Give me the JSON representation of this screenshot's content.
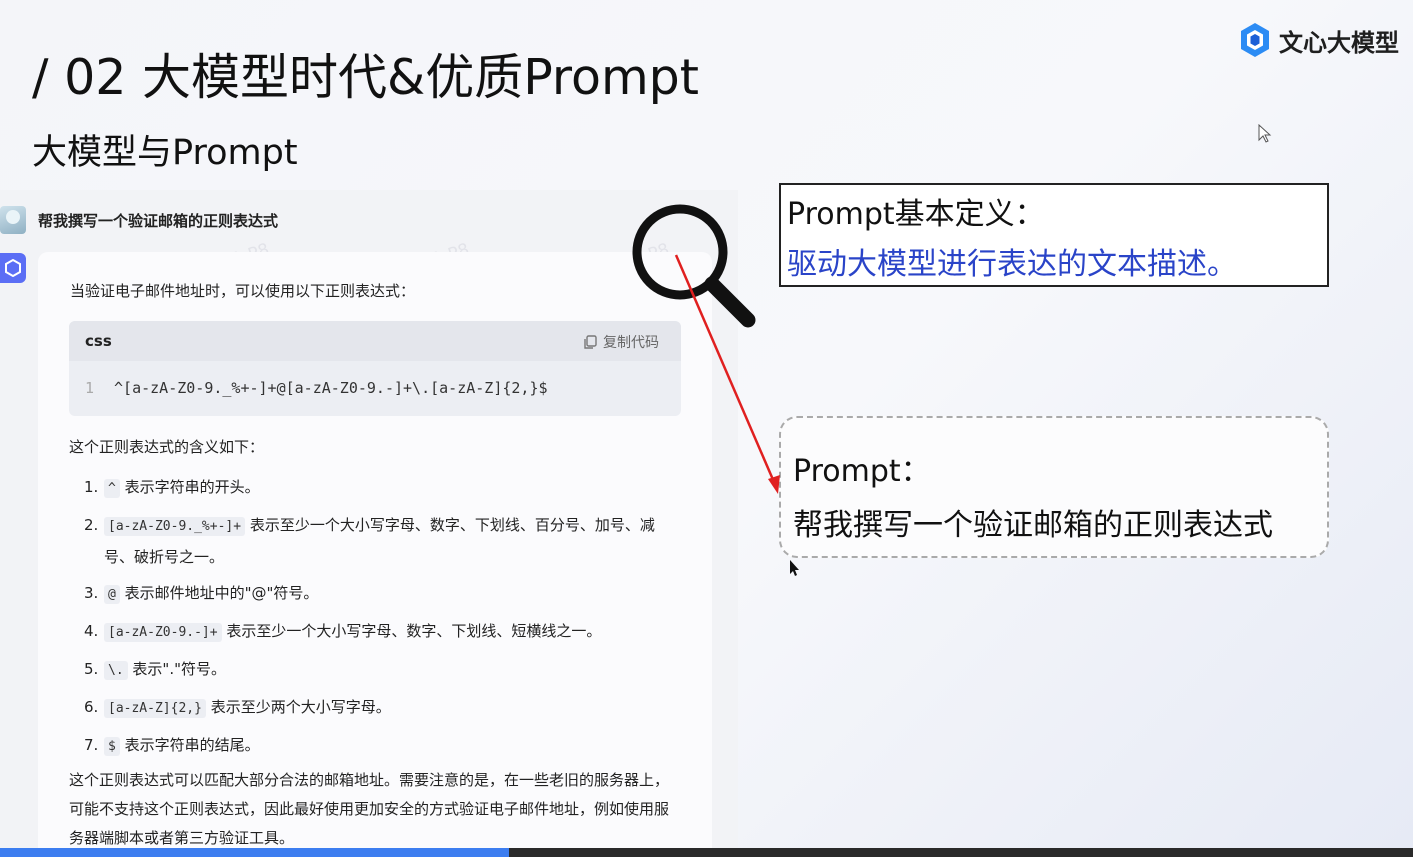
{
  "slide": {
    "title": "/ 02  大模型时代&优质Prompt",
    "subtitle": "大模型与Prompt",
    "brand": "文心大模型"
  },
  "chat": {
    "question": "帮我撰写一个验证邮箱的正则表达式",
    "intro": "当验证电子邮件地址时，可以使用以下正则表达式：",
    "code": {
      "lang": "css",
      "copy_label": "复制代码",
      "line_no": "1",
      "line": "^[a-zA-Z0-9._%+-]+@[a-zA-Z0-9.-]+\\.[a-zA-Z]{2,}$"
    },
    "meaning_heading": "这个正则表达式的含义如下：",
    "items": [
      {
        "num": "1.",
        "code": "^",
        "text": " 表示字符串的开头。"
      },
      {
        "num": "2.",
        "code": "[a-zA-Z0-9._%+-]+",
        "text": " 表示至少一个大小写字母、数字、下划线、百分号、加号、减号、破折号之一。"
      },
      {
        "num": "3.",
        "code": "@",
        "text": " 表示邮件地址中的\"@\"符号。"
      },
      {
        "num": "4.",
        "code": "[a-zA-Z0-9.-]+",
        "text": " 表示至少一个大小写字母、数字、下划线、短横线之一。"
      },
      {
        "num": "5.",
        "code": "\\.",
        "text": " 表示\".\"符号。"
      },
      {
        "num": "6.",
        "code": "[a-zA-Z]{2,}",
        "text": " 表示至少两个大小写字母。"
      },
      {
        "num": "7.",
        "code": "$",
        "text": " 表示字符串的结尾。"
      }
    ],
    "summary": "这个正则表达式可以匹配大部分合法的邮箱地址。需要注意的是，在一些老旧的服务器上，可能不支持这个正则表达式，因此最好使用更加安全的方式验证电子邮件地址，例如使用服务器端脚本或者第三方验证工具。",
    "watermark": "lergfnP8"
  },
  "definition": {
    "title": "Prompt基本定义：",
    "text": "驱动大模型进行表达的文本描述。"
  },
  "prompt_box": {
    "label": "Prompt：",
    "text": "帮我撰写一个验证邮箱的正则表达式"
  },
  "colors": {
    "accent_blue": "#2a44c8",
    "arrow_red": "#e02020",
    "bot_avatar": "#5b6ef5"
  },
  "video_progress": 0.36
}
